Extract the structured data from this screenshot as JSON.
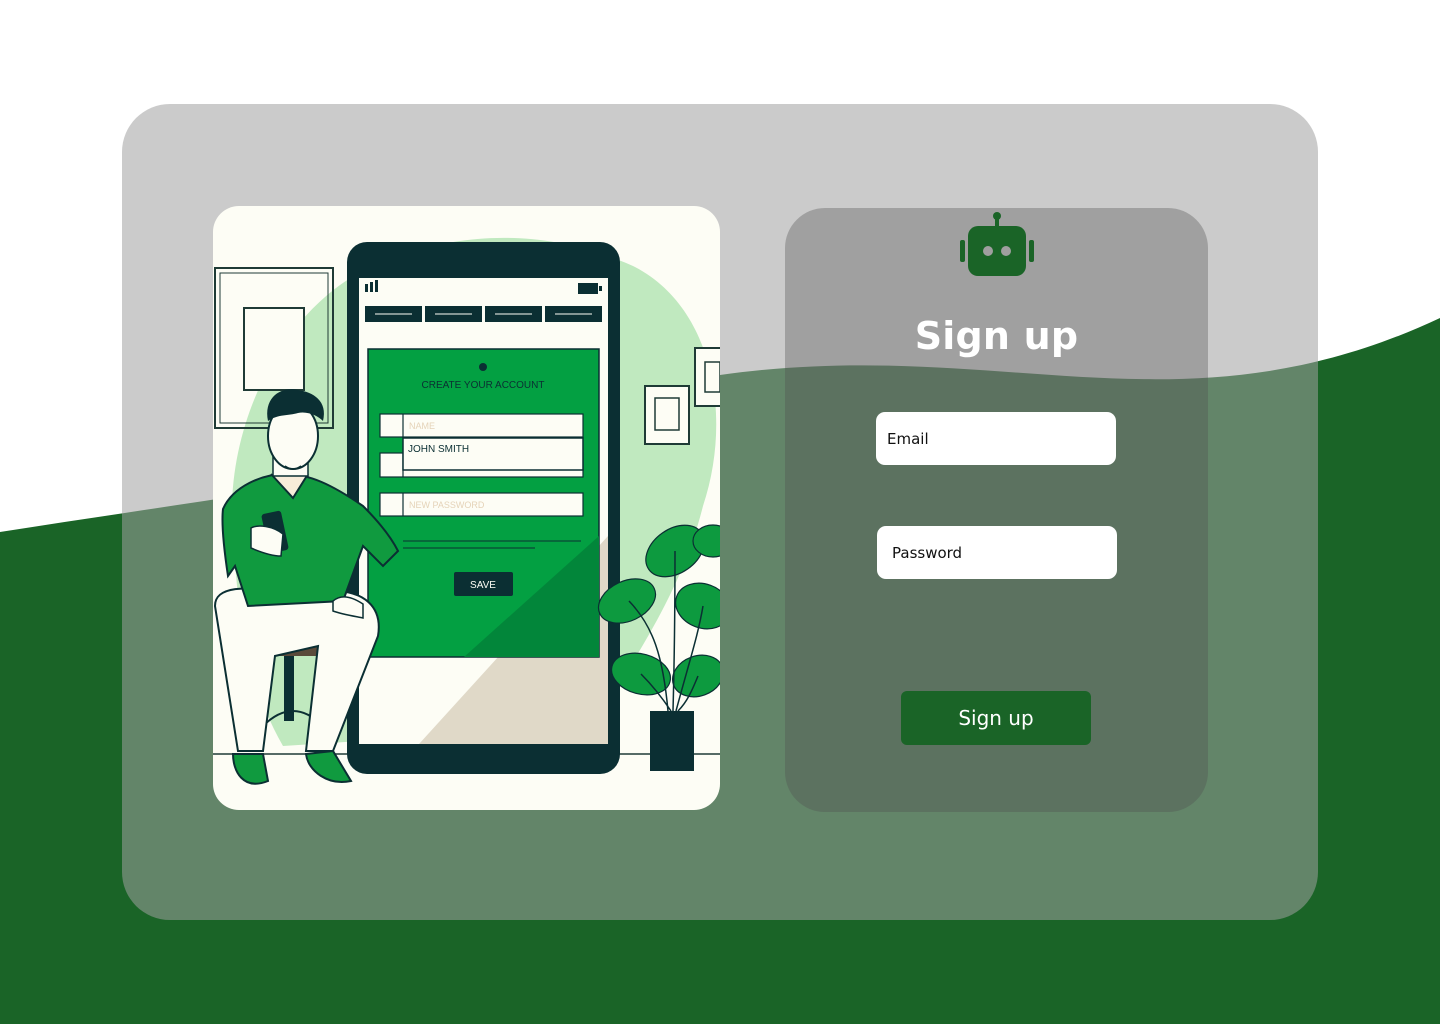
{
  "form": {
    "title": "Sign up",
    "email_placeholder": "Email",
    "password_placeholder": "Password",
    "submit_label": "Sign up",
    "icon": "robot-icon"
  },
  "illustration": {
    "screen_title": "CREATE YOUR ACCOUNT",
    "name_placeholder": "NAME",
    "name_value": "JOHN SMITH",
    "password_placeholder": "NEW PASSWORD",
    "save_label": "SAVE"
  },
  "colors": {
    "brand_green": "#1a6427",
    "dark_green": "#144d1f",
    "accent_green": "#03a042",
    "light_green": "#c0e9bf",
    "card_gray": "#cbcbcb"
  }
}
